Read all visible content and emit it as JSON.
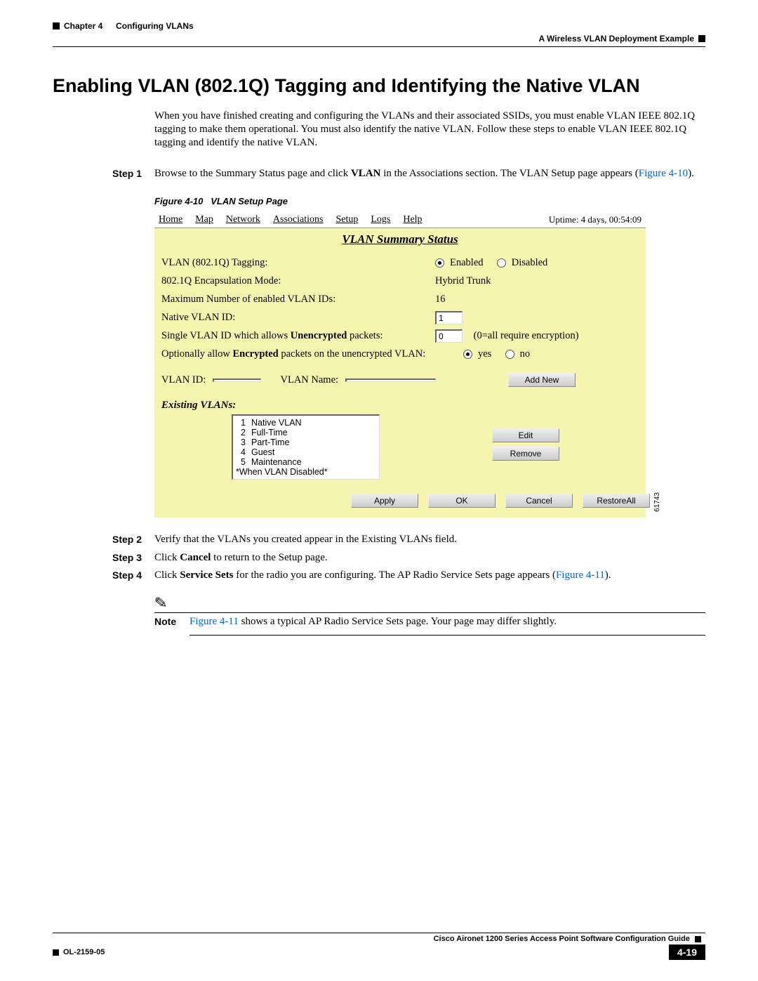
{
  "header": {
    "chapter": "Chapter 4",
    "chapter_title": "Configuring VLANs",
    "right": "A Wireless VLAN Deployment Example"
  },
  "section_title": "Enabling VLAN (802.1Q) Tagging and Identifying the Native VLAN",
  "intro": "When you have finished creating and configuring the VLANs and their associated SSIDs, you must enable VLAN IEEE 802.1Q tagging to make them operational. You must also identify the native VLAN. Follow these steps to enable VLAN IEEE 802.1Q tagging and identify the native VLAN.",
  "steps": {
    "s1": {
      "label": "Step 1",
      "pre": "Browse to the Summary Status page and click ",
      "bold": "VLAN",
      "post": " in the Associations section. The VLAN Setup page appears (",
      "link": "Figure 4-10",
      "tail": ")."
    },
    "s2": {
      "label": "Step 2",
      "text": "Verify that the VLANs you created appear in the Existing VLANs field."
    },
    "s3": {
      "label": "Step 3",
      "pre": "Click ",
      "bold": "Cancel",
      "post": " to return to the Setup page."
    },
    "s4": {
      "label": "Step 4",
      "pre": "Click ",
      "bold": "Service Sets",
      "post": " for the radio you are configuring. The AP Radio Service Sets page appears (",
      "link": "Figure 4-11",
      "tail": ")."
    }
  },
  "figure": {
    "caption_label": "Figure 4-10",
    "caption_text": "VLAN Setup Page",
    "nav": {
      "home": "Home",
      "map": "Map",
      "network": "Network",
      "assoc": "Associations",
      "setup": "Setup",
      "logs": "Logs",
      "help": "Help"
    },
    "uptime": "Uptime: 4 days, 00:54:09",
    "panel_title": "VLAN Summary Status",
    "rows": {
      "tagging_label": "VLAN (802.1Q) Tagging:",
      "enabled": "Enabled",
      "disabled": "Disabled",
      "encap_label": "802.1Q Encapsulation Mode:",
      "encap_value": "Hybrid Trunk",
      "max_label": "Maximum Number of enabled VLAN IDs:",
      "max_value": "16",
      "native_label": "Native VLAN ID:",
      "native_value": "1",
      "single_pre": "Single VLAN ID which allows ",
      "single_bold": "Unencrypted",
      "single_post": " packets:",
      "single_value": "0",
      "single_hint": "(0=all require encryption)",
      "opt_pre": "Optionally allow ",
      "opt_bold": "Encrypted",
      "opt_post": " packets on the unencrypted VLAN:",
      "yes": "yes",
      "no": "no"
    },
    "idrow": {
      "vlan_id": "VLAN ID:",
      "vlan_name": "VLAN Name:",
      "addnew": "Add New"
    },
    "existing_title": "Existing VLANs:",
    "list": [
      {
        "n": "1",
        "name": "Native VLAN"
      },
      {
        "n": "2",
        "name": "Full-Time"
      },
      {
        "n": "3",
        "name": "Part-Time"
      },
      {
        "n": "4",
        "name": "Guest"
      },
      {
        "n": "5",
        "name": "Maintenance"
      }
    ],
    "list_footer": "*When VLAN Disabled*",
    "edit_btn": "Edit",
    "remove_btn": "Remove",
    "bottom_buttons": {
      "apply": "Apply",
      "ok": "OK",
      "cancel": "Cancel",
      "restore": "RestoreAll"
    },
    "fig_id": "61743"
  },
  "note": {
    "label": "Note",
    "link": "Figure 4-11",
    "text": " shows a typical AP Radio Service Sets page. Your page may differ slightly."
  },
  "footer": {
    "guide": "Cisco Aironet 1200 Series Access Point Software Configuration Guide",
    "ol": "OL-2159-05",
    "page": "4-19"
  }
}
